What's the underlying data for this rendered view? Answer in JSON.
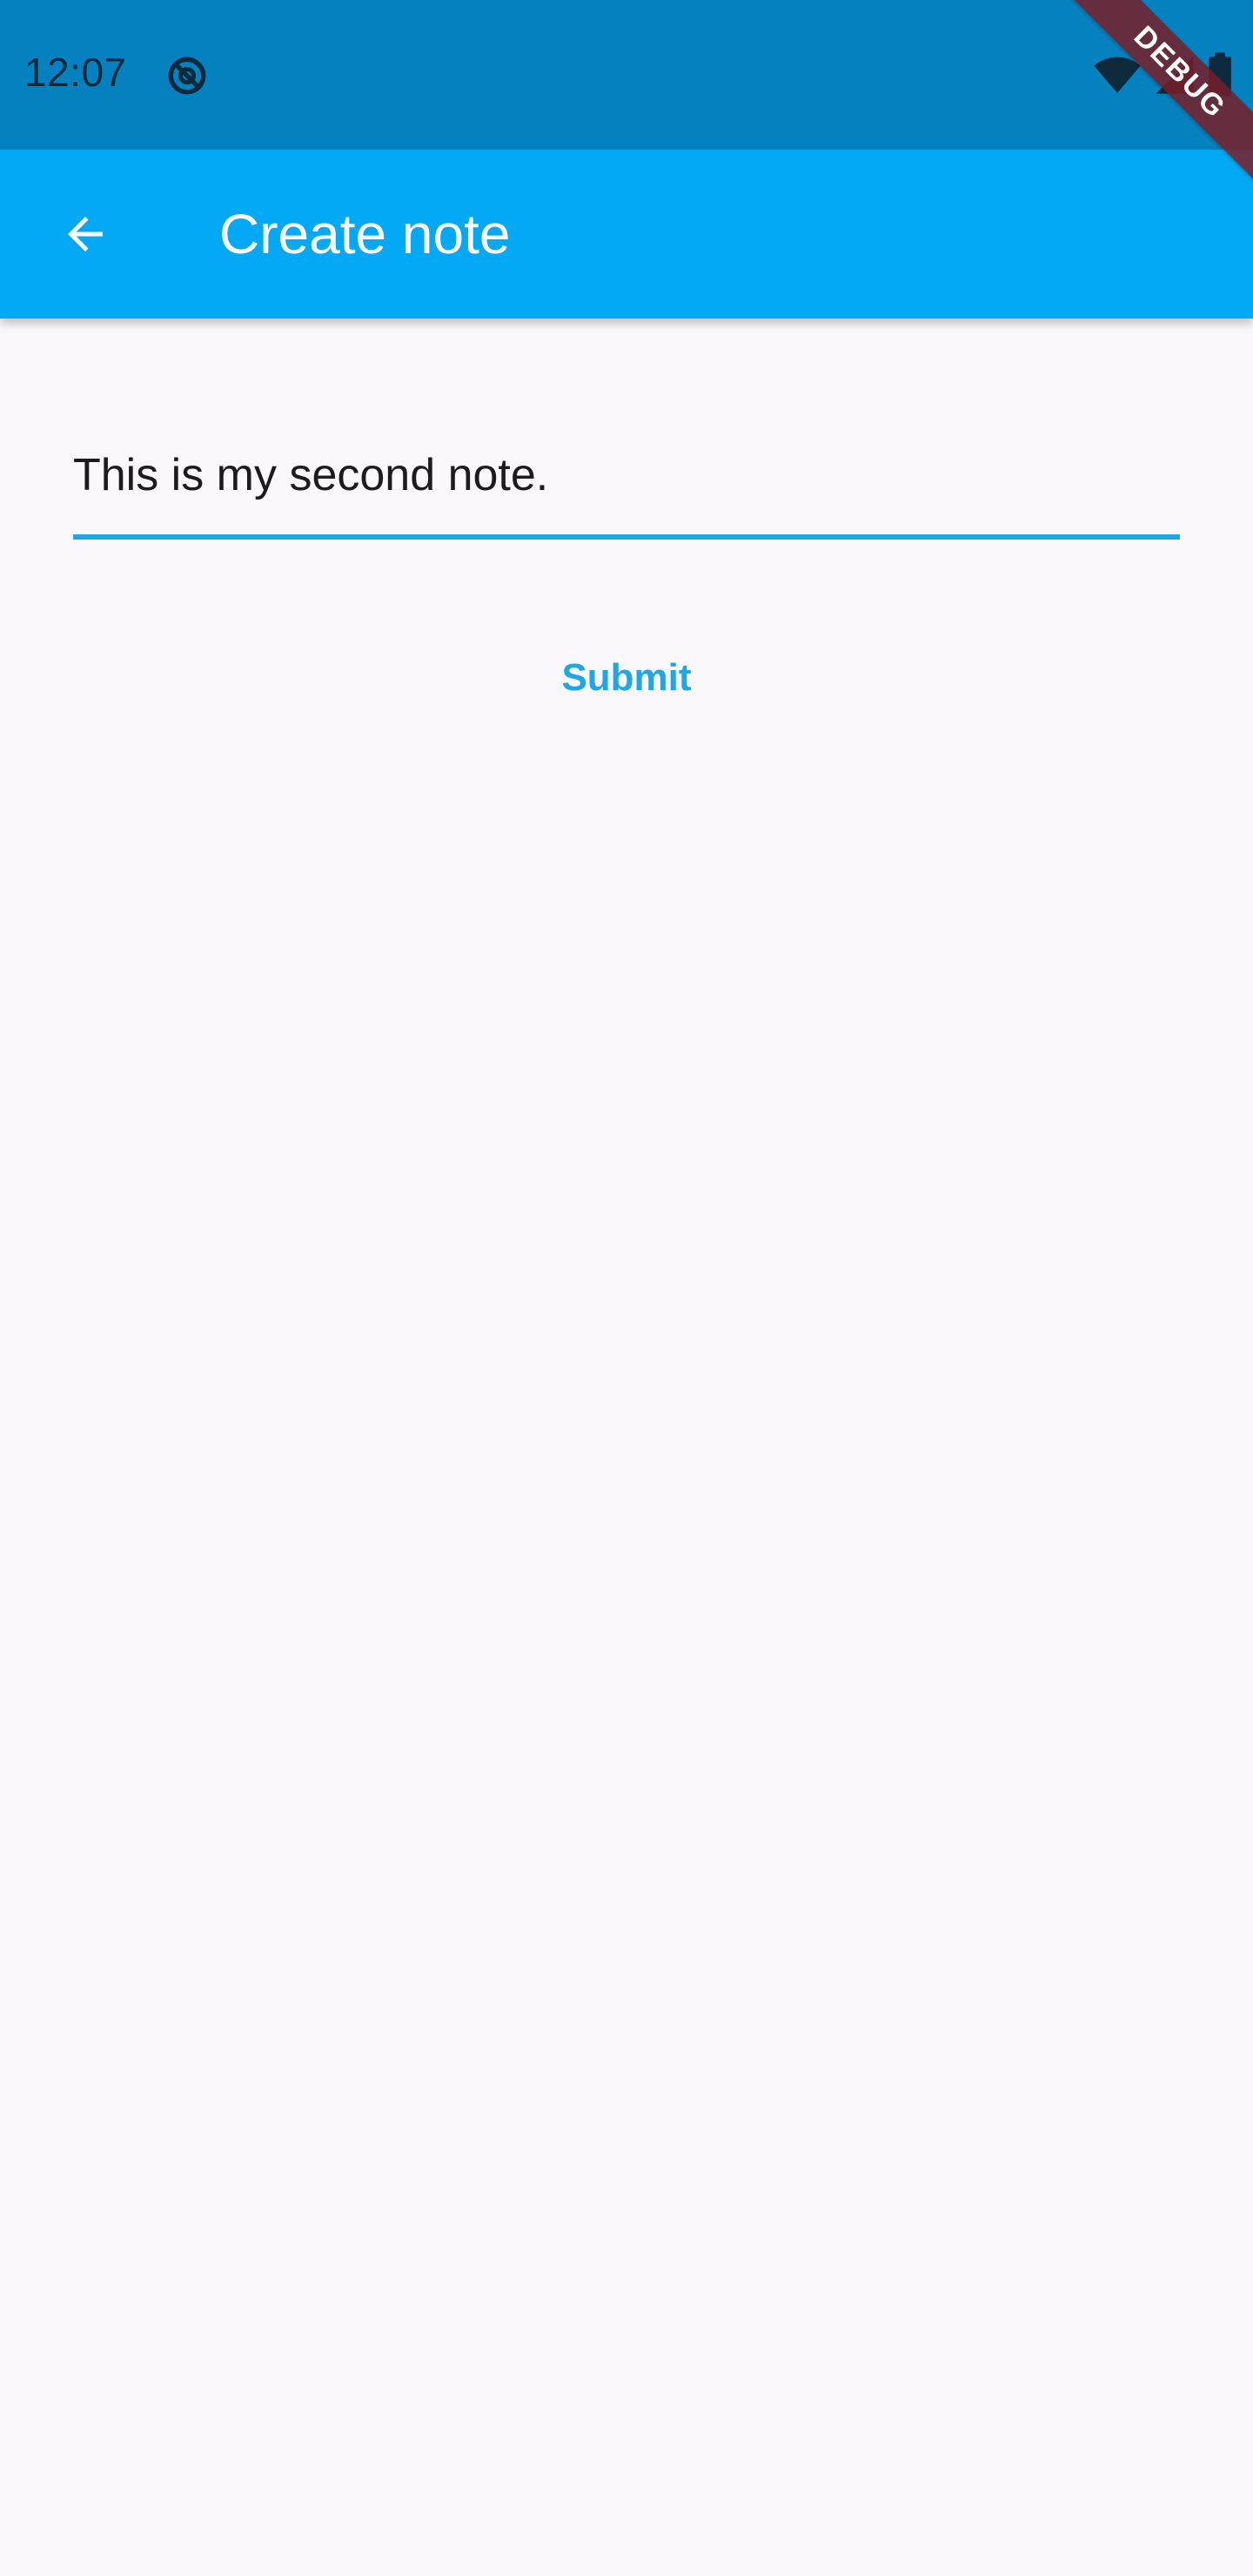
{
  "status_bar": {
    "time": "12:07",
    "icons": [
      "sync-icon",
      "wifi-icon",
      "signal-icon",
      "battery-icon"
    ]
  },
  "app_bar": {
    "title": "Create note",
    "back_icon": "arrow-back-icon"
  },
  "debug_banner": {
    "label": "DEBUG"
  },
  "form": {
    "note_value": "This is my second note.",
    "submit_label": "Submit"
  },
  "colors": {
    "status_bar": "#0382bf",
    "app_bar": "#03a9f4",
    "accent": "#1fa6e4",
    "background": "#faf8fc",
    "text": "#1c1b1f"
  }
}
